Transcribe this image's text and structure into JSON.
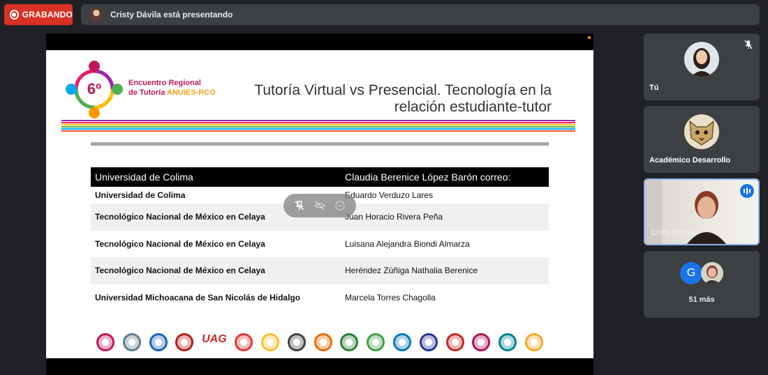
{
  "recording": {
    "label": "GRABANDO",
    "color": "#d93025"
  },
  "presenter_bar": {
    "text": "Cristy Dávila está presentando"
  },
  "slide": {
    "logo": {
      "number": "6º",
      "line1": "Encuentro Regional",
      "line2_prefix": "de Tutoría ",
      "line2_accent": "ANUIES-RCO"
    },
    "title_line1": "Tutoría Virtual vs Presencial. Tecnología en la",
    "title_line2": "relación estudiante-tutor",
    "stripe_colors": [
      "#9c27b0",
      "#e91e63",
      "#ffc107",
      "#4caf50",
      "#03a9f4",
      "#ff5722"
    ],
    "table": {
      "headers": [
        "Universidad de Colima",
        "Claudia Berenice López Barón correo:"
      ],
      "rows": [
        [
          "Universidad de Colima",
          "Eduardo Verduzo Lares"
        ],
        [
          "Tecnológico Nacional de México en Celaya",
          "Juan Horacio Rivera Peña"
        ],
        [
          "Tecnológico Nacional de México en Celaya",
          "Luisana Alejandra Biondi Almarza"
        ],
        [
          "Tecnológico Nacional de México en Celaya",
          "Heréndez Zúñiga Nathalia Berenice"
        ],
        [
          "Universidad Michoacana de San Nicolás de Hidalgo",
          "Marcela Torres Chagolla"
        ]
      ]
    },
    "logos": [
      {
        "type": "circle",
        "color": "#c2185b"
      },
      {
        "type": "circle",
        "color": "#607d8b"
      },
      {
        "type": "circle",
        "color": "#1565c0"
      },
      {
        "type": "circle",
        "color": "#b71c1c"
      },
      {
        "type": "text",
        "text": "UAG"
      },
      {
        "type": "circle",
        "color": "#e53935"
      },
      {
        "type": "circle",
        "color": "#fbc02d"
      },
      {
        "type": "circle",
        "color": "#424242"
      },
      {
        "type": "circle",
        "color": "#ef6c00"
      },
      {
        "type": "circle",
        "color": "#2e7d32"
      },
      {
        "type": "circle",
        "color": "#43a047"
      },
      {
        "type": "circle",
        "color": "#0277bd"
      },
      {
        "type": "circle",
        "color": "#283593"
      },
      {
        "type": "circle",
        "color": "#c62828"
      },
      {
        "type": "circle",
        "color": "#ad1457"
      },
      {
        "type": "circle",
        "color": "#00838f"
      },
      {
        "type": "circle",
        "color": "#f9a825"
      }
    ]
  },
  "participants": [
    {
      "name": "Tú",
      "muted": true
    },
    {
      "name": "Académico Desarrollo"
    },
    {
      "name": "Cristy Dávila",
      "speaking": true
    },
    {
      "initial": "G",
      "more_label": "51 más"
    }
  ]
}
